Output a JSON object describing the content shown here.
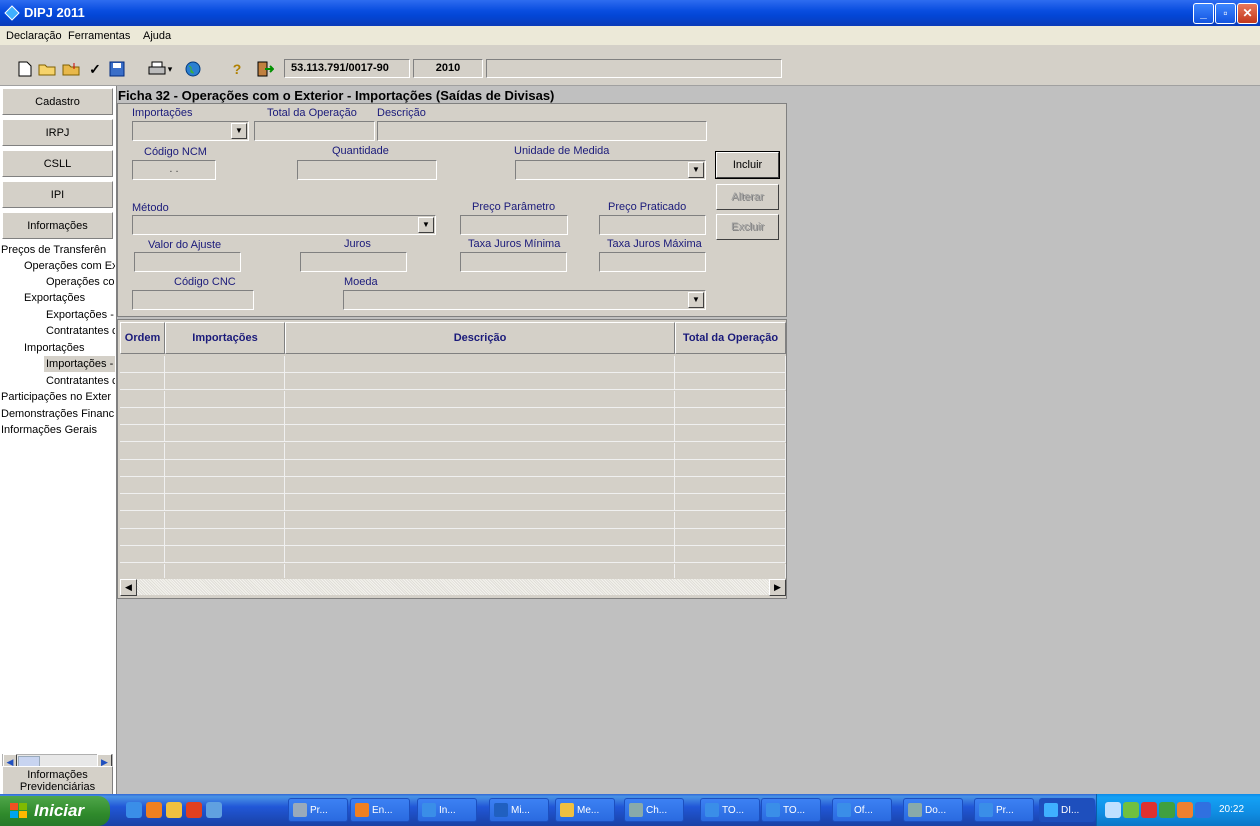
{
  "window": {
    "title": "DIPJ 2011"
  },
  "menu": [
    "Declaração",
    "Ferramentas",
    "Ajuda"
  ],
  "toolbar": {
    "cnpj": "53.113.791/0017-90",
    "year": "2010"
  },
  "nav": {
    "buttons": [
      "Cadastro",
      "IRPJ",
      "CSLL",
      "IPI",
      "Informações"
    ],
    "tree": [
      "Preços de Transferên",
      "Operações com Ex",
      "Operações co",
      "Exportações",
      "Exportações -",
      "Contratantes c",
      "Importações",
      "Importações -",
      "Contratantes c",
      "Participações no Exter",
      "Demonstrações Financ",
      "Informações Gerais"
    ],
    "bottom_button": [
      "Informações",
      "Previdenciárias"
    ]
  },
  "form": {
    "title": "Ficha 32 - Operações com o Exterior - Importações (Saídas de Divisas)",
    "labels": {
      "importacoes": "Importações",
      "total_operacao": "Total da Operação",
      "descricao": "Descrição",
      "codigo_ncm": "Código NCM",
      "quantidade": "Quantidade",
      "unidade_medida": "Unidade de Medida",
      "metodo": "Método",
      "preco_parametro": "Preço Parâmetro",
      "preco_praticado": "Preço Praticado",
      "valor_ajuste": "Valor do Ajuste",
      "juros": "Juros",
      "taxa_min": "Taxa Juros Mínima",
      "taxa_max": "Taxa Juros Máxima",
      "codigo_cnc": "Código CNC",
      "moeda": "Moeda"
    },
    "values": {
      "codigo_ncm": ". ."
    },
    "buttons": {
      "incluir": "Incluir",
      "alterar": "Alterar",
      "excluir": "Excluir"
    }
  },
  "grid": {
    "columns": [
      "Ordem",
      "Importações",
      "Descrição",
      "Total da Operação"
    ],
    "row_count": 13
  },
  "taskbar": {
    "start": "Iniciar",
    "tasks": [
      "Pr...",
      "En...",
      "In...",
      "Mi...",
      "Me...",
      "Ch...",
      "TO...",
      "TO...",
      "Of...",
      "Do...",
      "Pr...",
      "DI..."
    ],
    "clock": "20:22"
  },
  "colors": {
    "titlebar": "#0a4ee0",
    "label": "#1a1a7a",
    "face": "#d4d0c8"
  }
}
